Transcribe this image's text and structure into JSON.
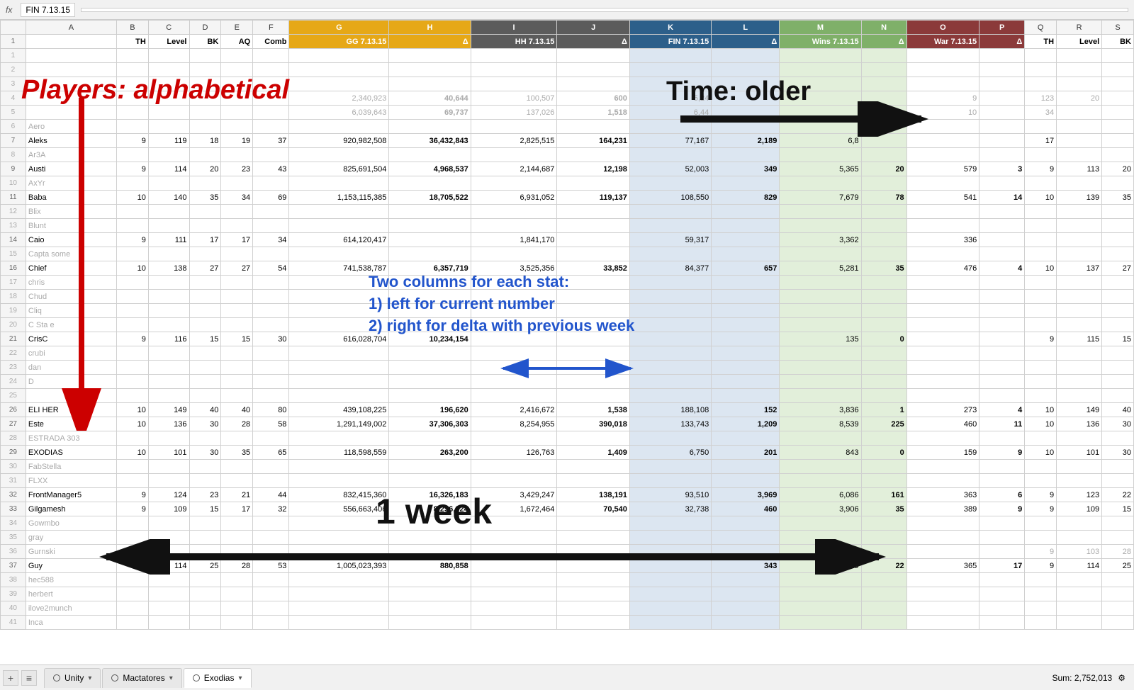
{
  "formula_bar": {
    "cell_ref": "FIN 7.13.15",
    "formula": ""
  },
  "header": {
    "columns": [
      "",
      "A",
      "B",
      "C",
      "D",
      "E",
      "F",
      "G",
      "H",
      "I",
      "J",
      "K",
      "L",
      "M",
      "N",
      "O",
      "P",
      "Q",
      "R",
      "S"
    ],
    "row1": {
      "A": "",
      "B": "TH",
      "C": "Level",
      "D": "BK",
      "E": "AQ",
      "F": "Comb",
      "G": "GG 7.13.15",
      "H": "Δ",
      "I": "HH 7.13.15",
      "J": "Δ",
      "K": "FIN 7.13.15",
      "L": "Δ",
      "M": "Wins 7.13.15",
      "N": "Δ",
      "O": "War 7.13.15",
      "P": "Δ",
      "Q": "TH",
      "R": "Level",
      "S": "BK"
    }
  },
  "annotations": {
    "players_label": "Players: alphabetical",
    "time_label": "Time: older",
    "two_columns_line1": "Two columns for each stat:",
    "two_columns_line2": "1) left for current number",
    "two_columns_line3": "2) right for delta with previous week",
    "one_week_label": "1 week"
  },
  "rows": [
    {
      "num": 1,
      "A": "",
      "B": "",
      "C": "",
      "D": "",
      "E": "",
      "F": "",
      "G": "",
      "H": "",
      "I": "",
      "J": "",
      "K": "",
      "L": "",
      "M": "",
      "N": "",
      "O": "",
      "P": "",
      "Q": "",
      "R": "",
      "S": "",
      "dim": true
    },
    {
      "num": 2,
      "A": "",
      "dim": true
    },
    {
      "num": 3,
      "A": "",
      "dim": true
    },
    {
      "num": 4,
      "A": "",
      "G": "2,340,923",
      "H": "40,644",
      "I": "100,507",
      "J": "600",
      "K": "5,24",
      "M": "",
      "O": "9",
      "Q": "123",
      "R": "20",
      "dim": true
    },
    {
      "num": 5,
      "A": "",
      "G": "6,039,643",
      "H": "69,737",
      "I": "137,026",
      "J": "1,518",
      "K": "6,44",
      "O": "10",
      "Q": "34",
      "dim": true
    },
    {
      "num": 6,
      "A": "Aero",
      "dim": true
    },
    {
      "num": 7,
      "A": "Aleks",
      "B": "9",
      "C": "119",
      "D": "18",
      "E": "19",
      "F": "37",
      "G": "920,982,508",
      "H": "36,432,843",
      "I": "2,825,515",
      "J": "164,231",
      "K": "77,167",
      "L": "2,189",
      "M": "6,8",
      "Q": "17"
    },
    {
      "num": 8,
      "A": "Ar3A",
      "dim": true
    },
    {
      "num": 9,
      "A": "Austi",
      "B": "9",
      "C": "114",
      "D": "20",
      "E": "23",
      "F": "43",
      "G": "825,691,504",
      "H": "4,968,537",
      "I": "2,144,687",
      "J": "12,198",
      "K": "52,003",
      "L": "349",
      "M": "5,365",
      "N": "20",
      "O": "579",
      "P": "3",
      "Q": "9",
      "R": "113",
      "S": "20"
    },
    {
      "num": 10,
      "A": "AxYr",
      "dim": true
    },
    {
      "num": 11,
      "A": "Baba",
      "B": "10",
      "C": "140",
      "D": "35",
      "E": "34",
      "F": "69",
      "G": "1,153,115,385",
      "H": "18,705,522",
      "I": "6,931,052",
      "J": "119,137",
      "K": "108,550",
      "L": "829",
      "M": "7,679",
      "N": "78",
      "O": "541",
      "P": "14",
      "Q": "10",
      "R": "139",
      "S": "35"
    },
    {
      "num": 12,
      "A": "Blix",
      "dim": true
    },
    {
      "num": 13,
      "A": "Blunt",
      "dim": true
    },
    {
      "num": 14,
      "A": "Caio",
      "B": "9",
      "C": "111",
      "D": "17",
      "E": "17",
      "F": "34",
      "G": "614,120,417",
      "I": "1,841,170",
      "K": "59,317",
      "M": "3,362",
      "O": "336"
    },
    {
      "num": 15,
      "A": "Capta some",
      "dim": true
    },
    {
      "num": 16,
      "A": "Chief",
      "B": "10",
      "C": "138",
      "D": "27",
      "E": "27",
      "F": "54",
      "G": "741,538,787",
      "H": "6,357,719",
      "I": "3,525,356",
      "J": "33,852",
      "K": "84,377",
      "L": "657",
      "M": "5,281",
      "N": "35",
      "O": "476",
      "P": "4",
      "Q": "10",
      "R": "137",
      "S": "27"
    },
    {
      "num": 17,
      "A": "chris",
      "dim": true
    },
    {
      "num": 18,
      "A": "Chud",
      "dim": true
    },
    {
      "num": 19,
      "A": "Cliq",
      "dim": true
    },
    {
      "num": 20,
      "A": "C Sta e",
      "dim": true
    },
    {
      "num": 21,
      "A": "CrisC",
      "B": "9",
      "C": "116",
      "D": "15",
      "E": "15",
      "F": "30",
      "G": "616,028,704",
      "H": "10,234,154",
      "M": "135",
      "N": "0",
      "Q": "9",
      "R": "115",
      "S": "15"
    },
    {
      "num": 22,
      "A": "crubi",
      "dim": true
    },
    {
      "num": 23,
      "A": "dan",
      "dim": true
    },
    {
      "num": 24,
      "A": "D",
      "dim": true
    },
    {
      "num": 25,
      "A": "",
      "dim": true
    },
    {
      "num": 26,
      "A": "ELI HER",
      "B": "10",
      "C": "149",
      "D": "40",
      "E": "40",
      "F": "80",
      "G": "439,108,225",
      "H": "196,620",
      "I": "2,416,672",
      "J": "1,538",
      "K": "188,108",
      "L": "152",
      "M": "3,836",
      "N": "1",
      "O": "273",
      "P": "4",
      "Q": "10",
      "R": "149",
      "S": "40"
    },
    {
      "num": 27,
      "A": "Este",
      "B": "10",
      "C": "136",
      "D": "30",
      "E": "28",
      "F": "58",
      "G": "1,291,149,002",
      "H": "37,306,303",
      "I": "8,254,955",
      "J": "390,018",
      "K": "133,743",
      "L": "1,209",
      "M": "8,539",
      "N": "225",
      "O": "460",
      "P": "11",
      "Q": "10",
      "R": "136",
      "S": "30"
    },
    {
      "num": 28,
      "A": "ESTRADA 303",
      "dim": true
    },
    {
      "num": 29,
      "A": "EXODIAS",
      "B": "10",
      "C": "101",
      "D": "30",
      "E": "35",
      "F": "65",
      "G": "118,598,559",
      "H": "263,200",
      "I": "126,763",
      "J": "1,409",
      "K": "6,750",
      "L": "201",
      "M": "843",
      "N": "0",
      "O": "159",
      "P": "9",
      "Q": "10",
      "R": "101",
      "S": "30"
    },
    {
      "num": 30,
      "A": "FabStella",
      "dim": true
    },
    {
      "num": 31,
      "A": "FLXX",
      "dim": true
    },
    {
      "num": 32,
      "A": "FrontManager5",
      "B": "9",
      "C": "124",
      "D": "23",
      "E": "21",
      "F": "44",
      "G": "832,415,360",
      "H": "16,326,183",
      "I": "3,429,247",
      "J": "138,191",
      "K": "93,510",
      "L": "3,969",
      "M": "6,086",
      "N": "161",
      "O": "363",
      "P": "6",
      "Q": "9",
      "R": "123",
      "S": "22"
    },
    {
      "num": 33,
      "A": "Gilgamesh",
      "B": "9",
      "C": "109",
      "D": "15",
      "E": "17",
      "F": "32",
      "G": "556,663,406",
      "H": "8,256,924",
      "I": "1,672,464",
      "J": "70,540",
      "K": "32,738",
      "L": "460",
      "M": "3,906",
      "N": "35",
      "O": "389",
      "P": "9",
      "Q": "9",
      "R": "109",
      "S": "15"
    },
    {
      "num": 34,
      "A": "Gowmbo",
      "dim": true
    },
    {
      "num": 35,
      "A": "gray",
      "dim": true
    },
    {
      "num": 36,
      "A": "Gurnski",
      "dim": true,
      "Q": "9",
      "R": "103",
      "S": "28"
    },
    {
      "num": 37,
      "A": "Guy",
      "B": "9",
      "C": "114",
      "D": "25",
      "E": "28",
      "F": "53",
      "G": "1,005,023,393",
      "H": "880,858",
      "K": "",
      "L": "343",
      "M": "5,429",
      "N": "22",
      "O": "365",
      "P": "17",
      "Q": "9",
      "R": "114",
      "S": "25"
    },
    {
      "num": 38,
      "A": "hec588",
      "dim": true
    },
    {
      "num": 39,
      "A": "herbert",
      "dim": true
    },
    {
      "num": 40,
      "A": "ilove2munch",
      "dim": true
    },
    {
      "num": 41,
      "A": "Inca",
      "dim": true
    }
  ],
  "tabs": [
    {
      "label": "Unity",
      "active": false
    },
    {
      "label": "Mactatores",
      "active": false
    },
    {
      "label": "Exodias",
      "active": true
    }
  ],
  "sum_bar": {
    "label": "Sum: 2,752,013",
    "settings_icon": "⚙"
  },
  "col_widths": {
    "row_num": 28,
    "A": 100,
    "B": 35,
    "C": 45,
    "D": 35,
    "E": 35,
    "F": 40,
    "G": 110,
    "H": 90,
    "I": 95,
    "J": 80,
    "K": 90,
    "L": 75,
    "M": 90,
    "N": 50,
    "O": 80,
    "P": 50,
    "Q": 35,
    "R": 50,
    "S": 35
  }
}
